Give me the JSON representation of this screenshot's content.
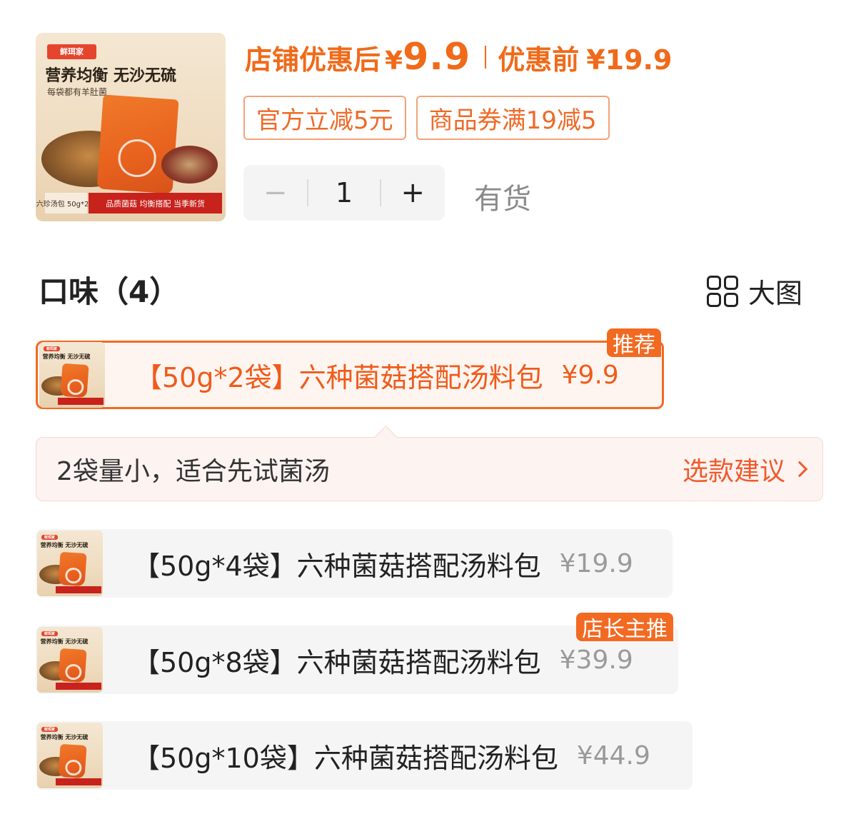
{
  "product": {
    "thumb": {
      "logo": "鲜珥家",
      "headline": "营养均衡 无沙无硫",
      "sub": "每袋都有羊肚菌",
      "pack_tag": "六珍汤包 50g*2袋",
      "banner": "品质菌菇 均衡搭配 当季新货"
    }
  },
  "pricing": {
    "after_label": "店铺优惠后",
    "currency": "¥",
    "after_price": "9.9",
    "before_label": "优惠前",
    "before_price": "¥19.9"
  },
  "coupons": [
    "官方立减5元",
    "商品券满19减5"
  ],
  "quantity": {
    "minus": "−",
    "value": "1",
    "plus": "+"
  },
  "stock_status": "有货",
  "flavor_section": {
    "title": "口味（4）",
    "view_label": "大图"
  },
  "options": [
    {
      "label": "【50g*2袋】六种菌菇搭配汤料包",
      "price": "¥9.9",
      "badge": "推荐",
      "selected": true
    },
    {
      "label": "【50g*4袋】六种菌菇搭配汤料包",
      "price": "¥19.9",
      "badge": "",
      "selected": false
    },
    {
      "label": "【50g*8袋】六种菌菇搭配汤料包",
      "price": "¥39.9",
      "badge": "店长主推",
      "selected": false
    },
    {
      "label": "【50g*10袋】六种菌菇搭配汤料包",
      "price": "¥44.9",
      "badge": "",
      "selected": false
    }
  ],
  "tip": {
    "text": "2袋量小，适合先试菌汤",
    "link": "选款建议"
  },
  "colors": {
    "accent": "#f26a22",
    "price": "#f06a19",
    "muted": "#9a9a9a"
  }
}
